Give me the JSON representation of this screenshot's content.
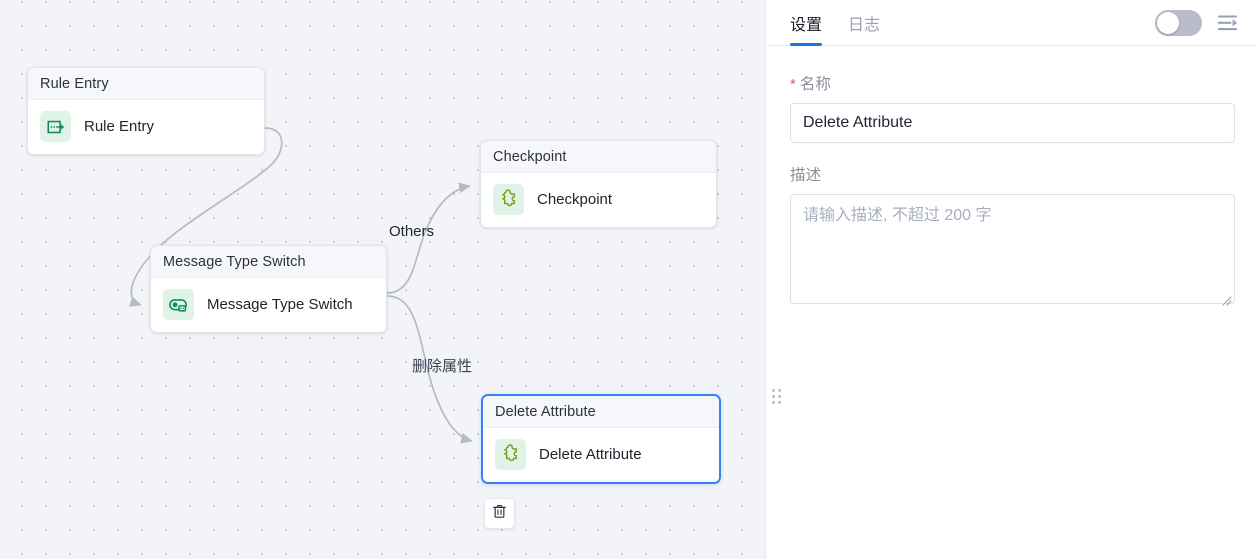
{
  "canvas": {
    "nodes": [
      {
        "id": "rule-entry",
        "header": "Rule Entry",
        "label": "Rule Entry",
        "icon": "rule-entry-icon",
        "selected": false
      },
      {
        "id": "msg-switch",
        "header": "Message Type Switch",
        "label": "Message Type Switch",
        "icon": "switch-icon",
        "selected": false
      },
      {
        "id": "checkpoint",
        "header": "Checkpoint",
        "label": "Checkpoint",
        "icon": "puzzle-icon",
        "selected": false
      },
      {
        "id": "delete-attr",
        "header": "Delete Attribute",
        "label": "Delete Attribute",
        "icon": "puzzle-icon",
        "selected": true
      }
    ],
    "edge_labels": [
      {
        "id": "others",
        "text": "Others"
      },
      {
        "id": "del-attr",
        "text": "删除属性"
      }
    ],
    "toolbar": {
      "delete_tooltip": "删除"
    },
    "colors": {
      "background": "#f3f4f8",
      "dot": "#c9ccd8",
      "edge": "#b6bac6",
      "selected_border": "#3b82f6",
      "icon_bg_green": "#dff4e6",
      "icon_teal": "#0f8a63",
      "icon_olive": "#7f9c1b"
    }
  },
  "panel": {
    "tabs": [
      {
        "id": "settings",
        "label": "设置",
        "active": true
      },
      {
        "id": "logs",
        "label": "日志",
        "active": false
      }
    ],
    "toggle": {
      "name": "panel-toggle",
      "checked": false
    },
    "menu_icon": "list-arrow-icon",
    "name_field": {
      "required_mark": "*",
      "label": "名称",
      "value": "Delete Attribute",
      "placeholder": ""
    },
    "desc_field": {
      "label": "描述",
      "value": "",
      "placeholder": "请输入描述, 不超过 200 字"
    },
    "accent": "#1a73e8"
  }
}
